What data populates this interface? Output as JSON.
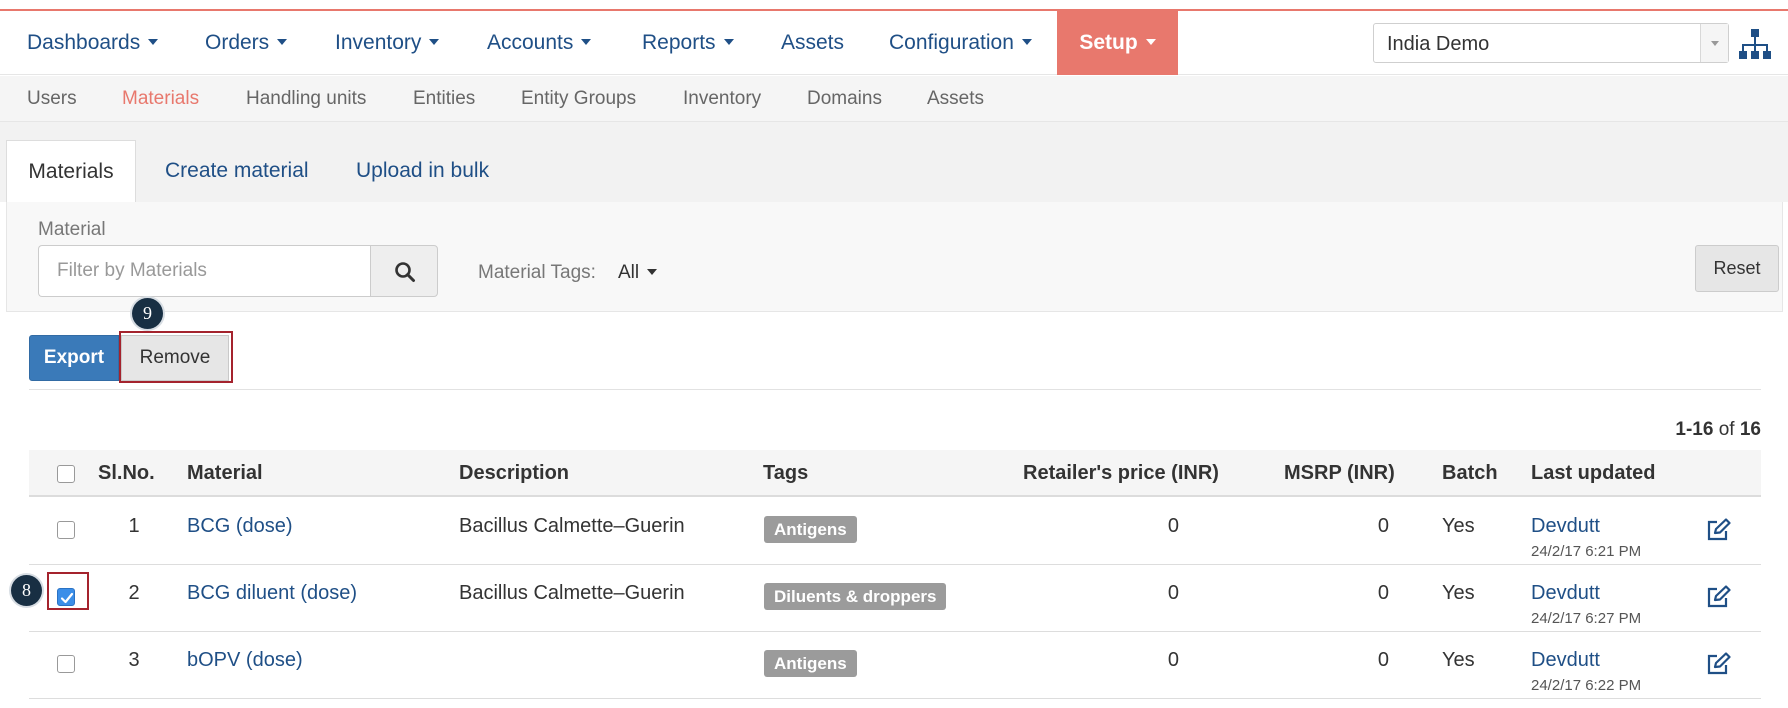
{
  "nav": {
    "items": [
      {
        "label": "Dashboards",
        "caret": true
      },
      {
        "label": "Orders",
        "caret": true
      },
      {
        "label": "Inventory",
        "caret": true
      },
      {
        "label": "Accounts",
        "caret": true
      },
      {
        "label": "Reports",
        "caret": true
      },
      {
        "label": "Assets",
        "caret": false
      },
      {
        "label": "Configuration",
        "caret": true
      },
      {
        "label": "Setup",
        "caret": true,
        "active": true
      }
    ],
    "domain": "India Demo"
  },
  "subnav": {
    "items": [
      "Users",
      "Materials",
      "Handling units",
      "Entities",
      "Entity Groups",
      "Inventory",
      "Domains",
      "Assets"
    ],
    "active": "Materials"
  },
  "tabs": [
    "Materials",
    "Create material",
    "Upload in bulk"
  ],
  "filter": {
    "label": "Material",
    "placeholder": "Filter by Materials",
    "tags_label": "Material Tags:",
    "tags_value": "All",
    "reset_label": "Reset"
  },
  "actions": {
    "export_label": "Export",
    "remove_label": "Remove"
  },
  "callouts": {
    "check": "8",
    "remove": "9"
  },
  "pager": {
    "range": "1-16",
    "of": "of",
    "total": "16"
  },
  "table": {
    "headers": {
      "slno": "Sl.No.",
      "material": "Material",
      "description": "Description",
      "tags": "Tags",
      "retailer_price": "Retailer's price (INR)",
      "msrp": "MSRP (INR)",
      "batch": "Batch",
      "last_updated": "Last updated"
    },
    "rows": [
      {
        "slno": "1",
        "material": "BCG (dose)",
        "description": "Bacillus Calmette–Guerin",
        "tag": "Antigens",
        "retailer_price": "0",
        "msrp": "0",
        "batch": "Yes",
        "user": "Devdutt",
        "time": "24/2/17 6:21 PM",
        "checked": false
      },
      {
        "slno": "2",
        "material": "BCG diluent (dose)",
        "description": "Bacillus Calmette–Guerin",
        "tag": "Diluents & droppers",
        "retailer_price": "0",
        "msrp": "0",
        "batch": "Yes",
        "user": "Devdutt",
        "time": "24/2/17 6:27 PM",
        "checked": true
      },
      {
        "slno": "3",
        "material": "bOPV (dose)",
        "description": "",
        "tag": "Antigens",
        "retailer_price": "0",
        "msrp": "0",
        "batch": "Yes",
        "user": "Devdutt",
        "time": "24/2/17 6:22 PM",
        "checked": false
      }
    ]
  },
  "colors": {
    "accent": "#e8786d",
    "link": "#1f4f86",
    "primary": "#3a7ab9",
    "highlight": "#a4232d",
    "tag": "#9b9b9b"
  }
}
